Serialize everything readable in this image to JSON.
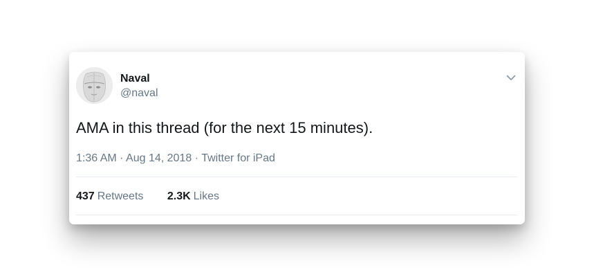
{
  "tweet": {
    "author_name": "Naval",
    "author_handle": "@naval",
    "text": "AMA in this thread (for the next 15 minutes).",
    "time": "1:36 AM",
    "separator": "·",
    "date": "Aug 14, 2018",
    "source": "Twitter for iPad"
  },
  "stats": {
    "retweets_count": "437",
    "retweets_label": "Retweets",
    "likes_count": "2.3K",
    "likes_label": "Likes"
  },
  "icons": {
    "menu": "chevron-down-icon",
    "avatar": "profile-avatar"
  },
  "colors": {
    "text_primary": "#14171a",
    "text_secondary": "#657786",
    "divider": "#e6ecf0"
  }
}
